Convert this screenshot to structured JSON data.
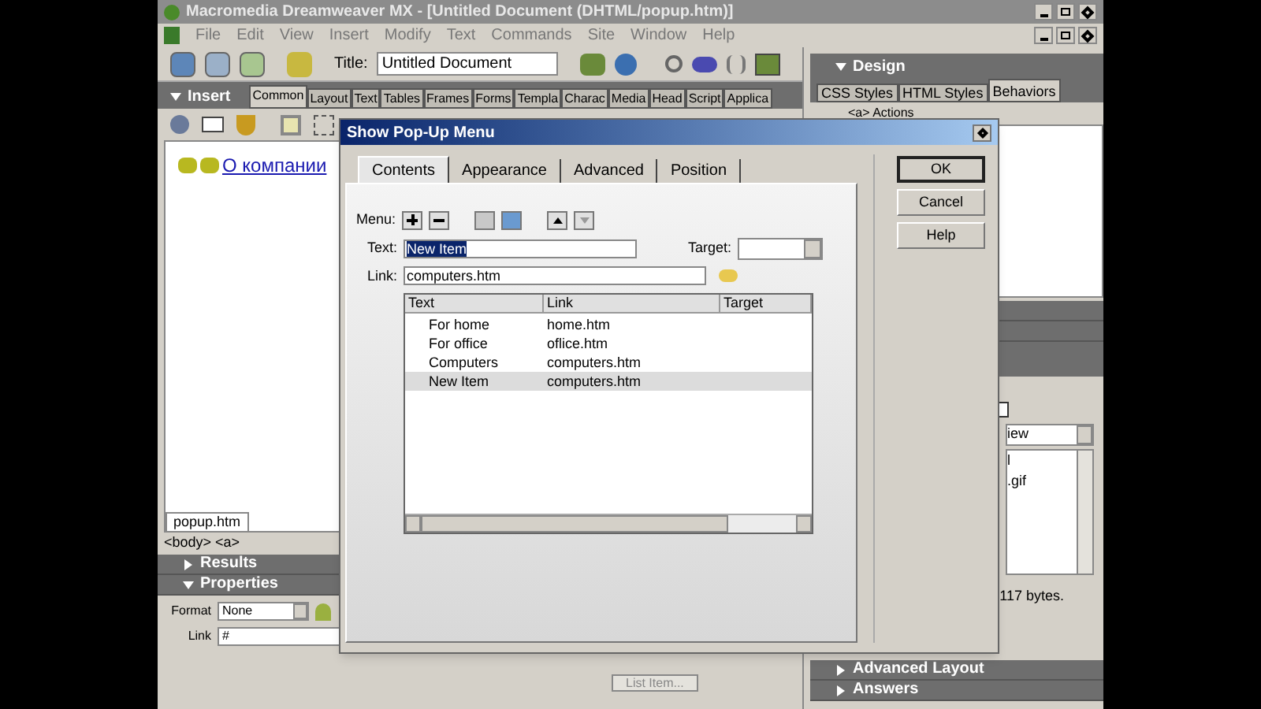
{
  "window": {
    "title": "Macromedia Dreamweaver MX - [Untitled Document (DHTML/popup.htm)]"
  },
  "menu_bar": [
    "File",
    "Edit",
    "View",
    "Insert",
    "Modify",
    "Text",
    "Commands",
    "Site",
    "Window",
    "Help"
  ],
  "toolbar": {
    "title_label": "Title:",
    "title_value": "Untitled Document"
  },
  "insert_panel": {
    "title": "Insert",
    "expanded": true,
    "tabs": [
      {
        "label": "Common",
        "selected": true
      },
      {
        "label": "Layout",
        "selected": false
      },
      {
        "label": "Text",
        "selected": false
      },
      {
        "label": "Tables",
        "selected": false
      },
      {
        "label": "Frames",
        "selected": false
      },
      {
        "label": "Forms",
        "selected": false
      },
      {
        "label": "Templa",
        "selected": false
      },
      {
        "label": "Charac",
        "selected": false
      },
      {
        "label": "Media",
        "selected": false
      },
      {
        "label": "Head",
        "selected": false
      },
      {
        "label": "Script",
        "selected": false
      },
      {
        "label": "Applica",
        "selected": false
      }
    ]
  },
  "document": {
    "link_text": "О компании",
    "tab": "popup.htm",
    "tag_selector": "<body> <a>"
  },
  "left_panels": [
    {
      "title": "Results",
      "expanded": false
    },
    {
      "title": "Properties",
      "expanded": true
    }
  ],
  "properties": {
    "format_label": "Format",
    "format_value": "None",
    "link_label": "Link",
    "link_value": "#",
    "list_item_button": "List Item..."
  },
  "design_panel": {
    "title": "Design",
    "expanded": true,
    "tabs": [
      {
        "label": "CSS Styles",
        "selected": false
      },
      {
        "label": "HTML Styles",
        "selected": false
      },
      {
        "label": "Behaviors",
        "selected": true
      }
    ],
    "actions_label": "<a> Actions"
  },
  "files_panel": {
    "view_value": "iew",
    "files": [
      "l",
      ".gif"
    ],
    "status": "117 bytes."
  },
  "right_panels": [
    {
      "title": "Advanced Layout",
      "expanded": false
    },
    {
      "title": "Answers",
      "expanded": false
    }
  ],
  "dialog": {
    "title": "Show Pop-Up Menu",
    "tabs": [
      {
        "label": "Contents",
        "selected": true
      },
      {
        "label": "Appearance",
        "selected": false
      },
      {
        "label": "Advanced",
        "selected": false
      },
      {
        "label": "Position",
        "selected": false
      }
    ],
    "menu_label": "Menu:",
    "text_label": "Text:",
    "text_value": "New Item",
    "target_label": "Target:",
    "link_label": "Link:",
    "link_value": "computers.htm",
    "columns": [
      "Text",
      "Link",
      "Target"
    ],
    "rows": [
      {
        "text": "For home",
        "link": "home.htm",
        "selected": false
      },
      {
        "text": "For office",
        "link": "oflice.htm",
        "selected": false
      },
      {
        "text": "Computers",
        "link": "computers.htm",
        "selected": false
      },
      {
        "text": "New Item",
        "link": "computers.htm",
        "selected": true
      }
    ],
    "buttons": [
      "OK",
      "Cancel",
      "Help"
    ]
  }
}
